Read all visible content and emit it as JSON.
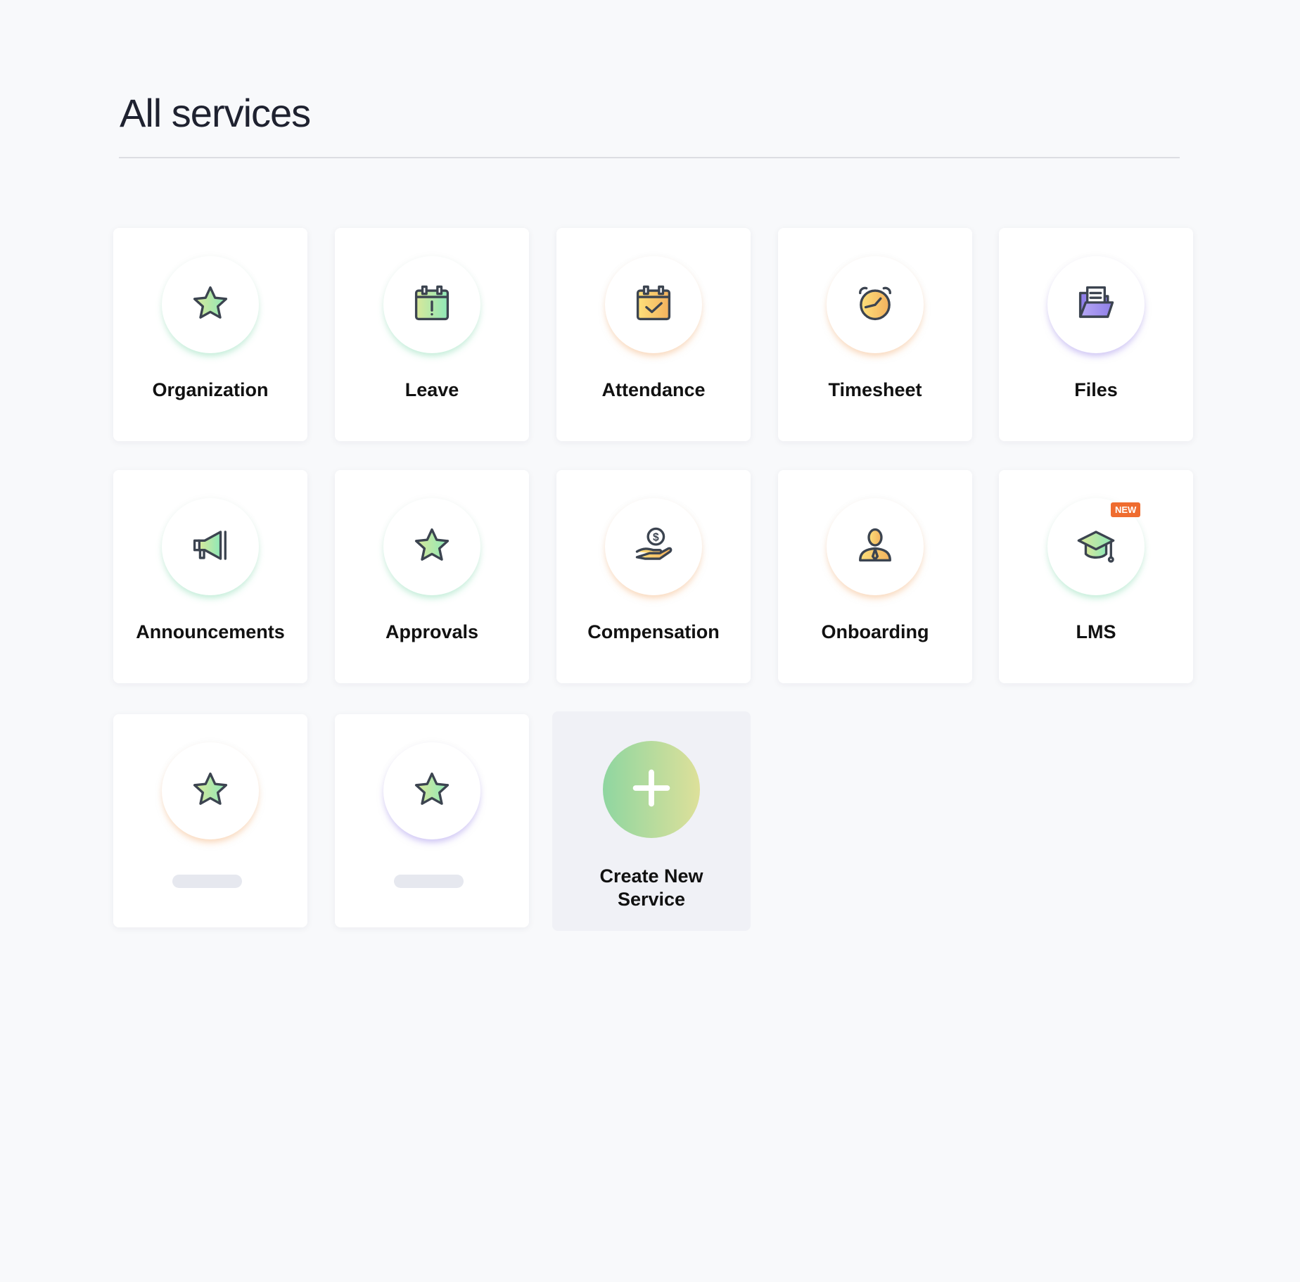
{
  "page": {
    "title": "All services"
  },
  "services": [
    {
      "label": "Organization",
      "icon": "star-icon"
    },
    {
      "label": "Leave",
      "icon": "calendar-alert-icon"
    },
    {
      "label": "Attendance",
      "icon": "calendar-check-icon"
    },
    {
      "label": "Timesheet",
      "icon": "alarm-clock-icon"
    },
    {
      "label": "Files",
      "icon": "folder-icon"
    },
    {
      "label": "Announcements",
      "icon": "megaphone-icon"
    },
    {
      "label": "Approvals",
      "icon": "star-icon"
    },
    {
      "label": "Compensation",
      "icon": "hand-coin-icon"
    },
    {
      "label": "Onboarding",
      "icon": "person-icon"
    },
    {
      "label": "LMS",
      "icon": "graduation-cap-icon",
      "badge": "NEW"
    }
  ],
  "create": {
    "label": "Create New Service",
    "icon": "plus-icon"
  },
  "colors": {
    "badge": "#ef6c2f",
    "icon_stroke": "#3c4450"
  }
}
